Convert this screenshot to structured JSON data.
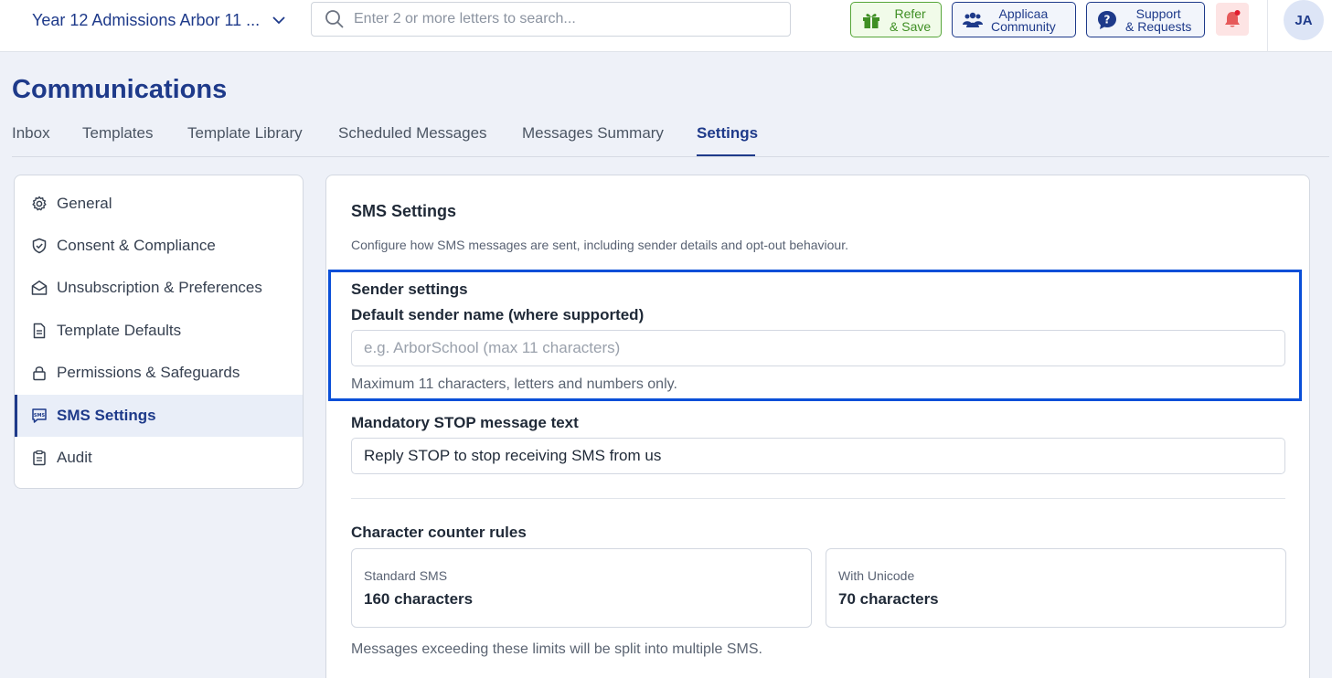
{
  "header": {
    "school_name": "Year 12 Admissions Arbor 11 ...",
    "search_placeholder": "Enter 2 or more letters to search...",
    "refer_line1": "Refer",
    "refer_line2": "& Save",
    "community_line1": "Applicaa",
    "community_line2": "Community",
    "support_line1": "Support",
    "support_line2": "& Requests",
    "avatar_initials": "JA"
  },
  "page": {
    "title": "Communications"
  },
  "tabs": [
    {
      "label": "Inbox",
      "active": false
    },
    {
      "label": "Templates",
      "active": false
    },
    {
      "label": "Template Library",
      "active": false
    },
    {
      "label": "Scheduled Messages",
      "active": false
    },
    {
      "label": "Messages Summary",
      "active": false
    },
    {
      "label": "Settings",
      "active": true
    }
  ],
  "sidebar": {
    "items": [
      {
        "label": "General",
        "icon": "gear-icon",
        "active": false
      },
      {
        "label": "Consent & Compliance",
        "icon": "shield-check-icon",
        "active": false
      },
      {
        "label": "Unsubscription & Preferences",
        "icon": "envelope-open-icon",
        "active": false
      },
      {
        "label": "Template Defaults",
        "icon": "document-icon",
        "active": false
      },
      {
        "label": "Permissions & Safeguards",
        "icon": "lock-icon",
        "active": false
      },
      {
        "label": "SMS Settings",
        "icon": "sms-icon",
        "active": true
      },
      {
        "label": "Audit",
        "icon": "clipboard-icon",
        "active": false
      }
    ]
  },
  "sms": {
    "title": "SMS Settings",
    "description": "Configure how SMS messages are sent, including sender details and opt-out behaviour.",
    "sender_section": "Sender settings",
    "sender_label": "Default sender name (where supported)",
    "sender_value": "",
    "sender_placeholder": "e.g. ArborSchool (max 11 characters)",
    "sender_help": "Maximum 11 characters, letters and numbers only.",
    "stop_label": "Mandatory STOP message text",
    "stop_value": "Reply STOP to stop receiving SMS from us",
    "counter_section": "Character counter rules",
    "standard_label": "Standard SMS",
    "standard_value": "160 characters",
    "unicode_label": "With Unicode",
    "unicode_value": "70 characters",
    "counter_help": "Messages exceeding these limits will be split into multiple SMS."
  },
  "colors": {
    "brand": "#1e3a8a",
    "highlight": "#0a4fd8",
    "refer_green": "#3f8f24",
    "bell_red": "#e11d2e"
  }
}
